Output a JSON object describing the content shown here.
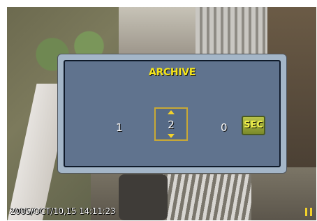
{
  "dialog": {
    "title": "ARCHIVE",
    "values": {
      "left": "1",
      "selected": "2",
      "right": "0"
    },
    "unit_label": "SEC"
  },
  "overlay": {
    "timestamp": "2005/OCT/10,15 14:11:23"
  },
  "icons": {
    "spin_up": "arrow-up-icon",
    "spin_down": "arrow-down-icon",
    "pause": "pause-icon"
  },
  "colors": {
    "title": "#f5e51a",
    "dialog_inner": "#60738e",
    "selector_border": "#c9a935"
  }
}
